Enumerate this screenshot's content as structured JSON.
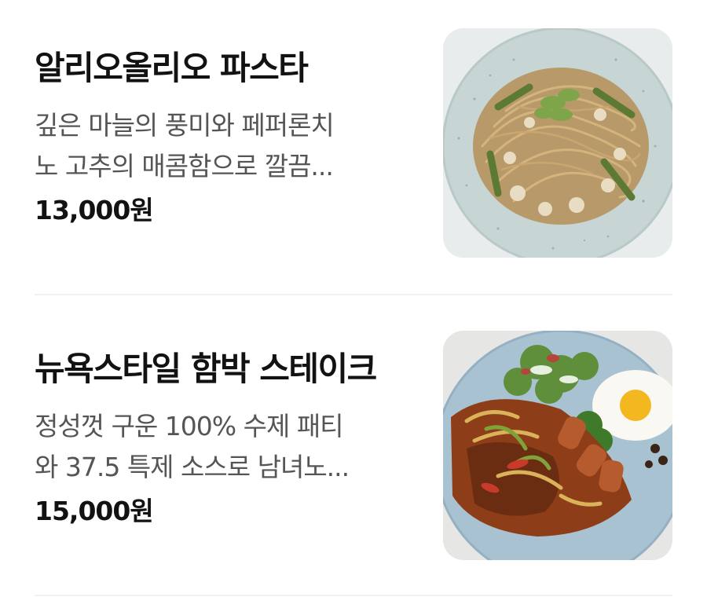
{
  "menu": {
    "items": [
      {
        "name": "알리오올리오 파스타",
        "description_lines": [
          "깊은 마늘의 풍미와 페퍼론치",
          "노 고추의 매콤함으로 깔끔..."
        ],
        "price": "13,000원",
        "image_icon": "pasta-dish-photo"
      },
      {
        "name": "뉴욕스타일 함박 스테이크",
        "description_lines": [
          "정성껏 구운 100% 수제 패티",
          "와 37.5 특제 소스로 남녀노..."
        ],
        "price": "15,000원",
        "image_icon": "hamburg-steak-dish-photo"
      }
    ]
  },
  "colors": {
    "title": "#121212",
    "description": "#555555",
    "divider": "#f1f1f1",
    "plate_pasta": "#c9d8d6",
    "plate_steak": "#a9c3d3"
  }
}
